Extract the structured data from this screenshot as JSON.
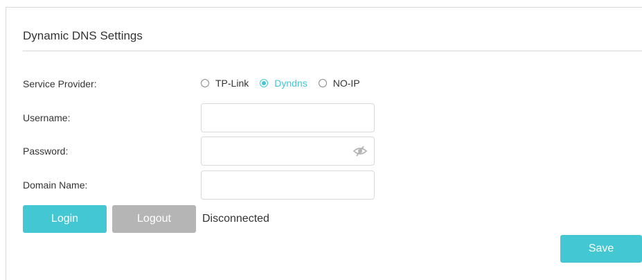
{
  "section": {
    "title": "Dynamic DNS Settings"
  },
  "service_provider": {
    "label": "Service Provider:",
    "options": [
      {
        "label": "TP-Link",
        "checked": false
      },
      {
        "label": "Dyndns",
        "checked": true
      },
      {
        "label": "NO-IP",
        "checked": false
      }
    ]
  },
  "username": {
    "label": "Username:",
    "value": "",
    "placeholder": ""
  },
  "password": {
    "label": "Password:",
    "value": "",
    "placeholder": "",
    "visibility_icon": "eye-slash-icon"
  },
  "domain": {
    "label": "Domain Name:",
    "value": "",
    "placeholder": ""
  },
  "actions": {
    "login_label": "Login",
    "logout_label": "Logout",
    "status_text": "Disconnected",
    "save_label": "Save"
  },
  "colors": {
    "accent": "#42c7d3",
    "disabled_button": "#b5b5b5",
    "text": "#333333",
    "border": "#d9d9d9"
  }
}
